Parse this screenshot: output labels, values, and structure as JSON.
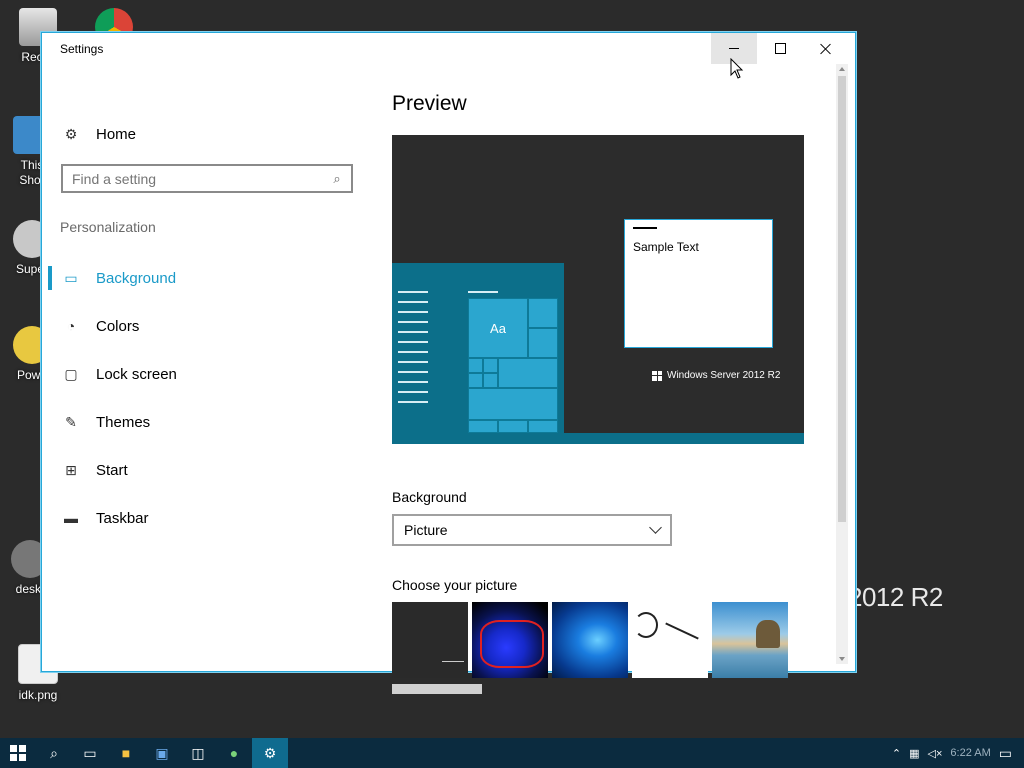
{
  "desktop": {
    "icons": [
      {
        "label": "Recyc"
      },
      {
        "label": "This\nShor"
      },
      {
        "label": "Super"
      },
      {
        "label": "Powe"
      },
      {
        "label": "deskt"
      },
      {
        "label": "idk.png"
      }
    ],
    "wallpaper_text": "2012 R2"
  },
  "window": {
    "title": "Settings",
    "nav": {
      "home": "Home",
      "search_placeholder": "Find a setting",
      "section": "Personalization",
      "items": [
        {
          "label": "Background",
          "icon": "image-icon",
          "active": true
        },
        {
          "label": "Colors",
          "icon": "palette-icon"
        },
        {
          "label": "Lock screen",
          "icon": "lock-screen-icon"
        },
        {
          "label": "Themes",
          "icon": "themes-icon"
        },
        {
          "label": "Start",
          "icon": "start-icon"
        },
        {
          "label": "Taskbar",
          "icon": "taskbar-icon"
        }
      ]
    },
    "content": {
      "preview_title": "Preview",
      "sample_text": "Sample Text",
      "preview_tile_text": "Aa",
      "brand_text": "Windows Server 2012 R2",
      "background_label": "Background",
      "background_value": "Picture",
      "choose_label": "Choose your picture"
    }
  },
  "taskbar": {
    "clock": "6:22 AM"
  },
  "colors": {
    "accent": "#1a9ac8",
    "taskbar": "#0b2b3f",
    "preview_accent": "#0c6f8a"
  }
}
